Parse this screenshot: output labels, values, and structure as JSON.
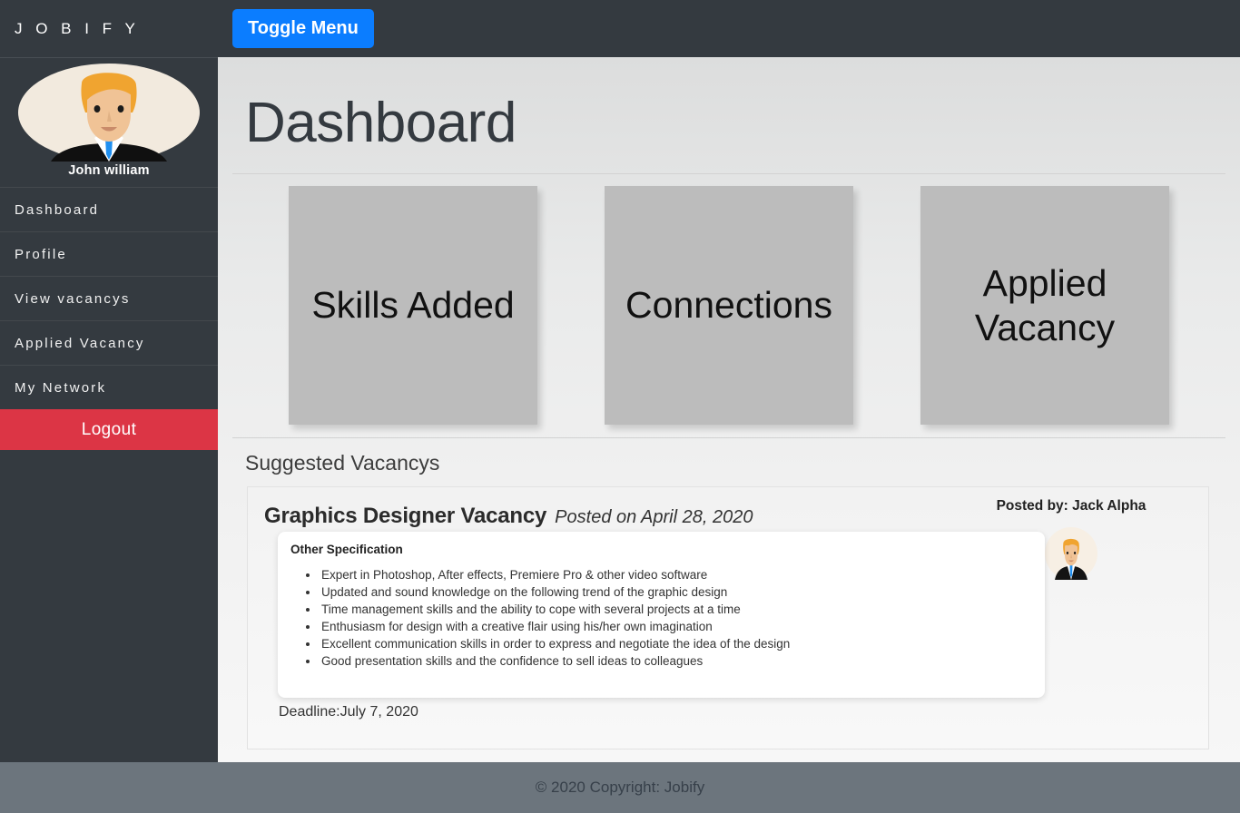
{
  "topbar": {
    "brand": "J O B I F Y",
    "toggle_label": "Toggle Menu",
    "toggle_color": "#0b7dff"
  },
  "sidebar": {
    "user_name": "John william",
    "avatar_icon": "businessman-avatar",
    "items": [
      {
        "label": "Dashboard"
      },
      {
        "label": "Profile"
      },
      {
        "label": "View vacancys"
      },
      {
        "label": "Applied Vacancy"
      },
      {
        "label": "My Network"
      }
    ],
    "logout_label": "Logout",
    "logout_color": "#dc3545",
    "background_color": "#343a40"
  },
  "main": {
    "page_title": "Dashboard",
    "cards": [
      {
        "label": "Skills Added"
      },
      {
        "label": "Connections"
      },
      {
        "label": "Applied Vacancy"
      }
    ],
    "card_color": "#bcbcbc",
    "section_title": "Suggested Vacancys",
    "vacancy": {
      "title": "Graphics Designer Vacancy",
      "posted_on": "Posted on April 28, 2020",
      "posted_by": "Posted by: Jack Alpha",
      "poster_avatar_icon": "businessman-avatar",
      "spec_title": "Other Specification",
      "specs": [
        "Expert in Photoshop, After effects, Premiere Pro & other video software",
        "Updated and sound knowledge on the following trend of the graphic design",
        "Time management skills and the ability to cope with several projects at a time",
        "Enthusiasm for design with a creative flair using his/her own imagination",
        "Excellent communication skills in order to express and negotiate the idea of the design",
        "Good presentation skills and the confidence to sell ideas to colleagues"
      ],
      "deadline": "Deadline:July 7, 2020"
    }
  },
  "footer": {
    "copyright": "© 2020 Copyright: Jobify",
    "background_color": "#6c757d"
  }
}
